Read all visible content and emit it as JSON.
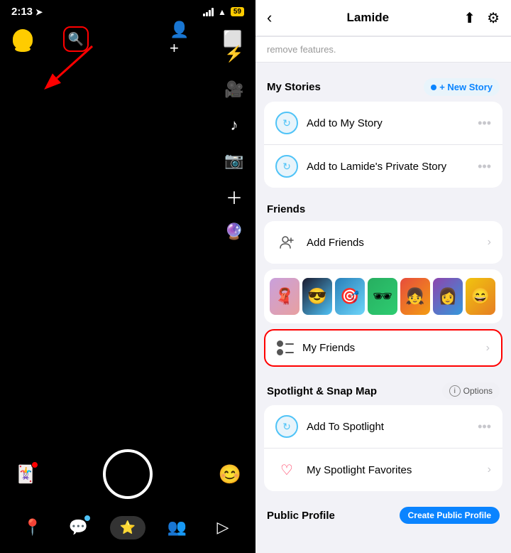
{
  "left": {
    "time": "2:13",
    "location_arrow": "➤",
    "battery": "59",
    "search_icon": "🔍",
    "controls": {
      "add_friend": "➕",
      "scan": "⬜",
      "flash_off": "⚡✕",
      "video": "📹",
      "music": "♪",
      "camera_flip": "📷",
      "plus": "＋",
      "lens": "🔮"
    },
    "bottom": {
      "cards": "🃏",
      "emoji": "😊",
      "map": "📍",
      "chat": "💬",
      "snap": "👻",
      "friends": "👥",
      "send": "▷"
    }
  },
  "right": {
    "back_label": "‹",
    "title": "Lamide",
    "upload_icon": "⬆",
    "settings_icon": "⚙",
    "teaser_text": "remove features.",
    "stories_section": "My Stories",
    "new_story_label": "+ New Story",
    "add_to_my_story": "Add to My Story",
    "add_to_private": "Add to Lamide's Private Story",
    "friends_section": "Friends",
    "add_friends": "Add Friends",
    "my_friends": "My Friends",
    "spotlight_section": "Spotlight & Snap Map",
    "options_label": "Options",
    "add_to_spotlight": "Add To Spotlight",
    "spotlight_favorites": "My Spotlight Favorites",
    "public_profile_section": "Public Profile",
    "colors": {
      "accent_blue": "#0a84ff",
      "accent_red": "#ff2d55",
      "highlight_border": "#ff0000"
    }
  }
}
